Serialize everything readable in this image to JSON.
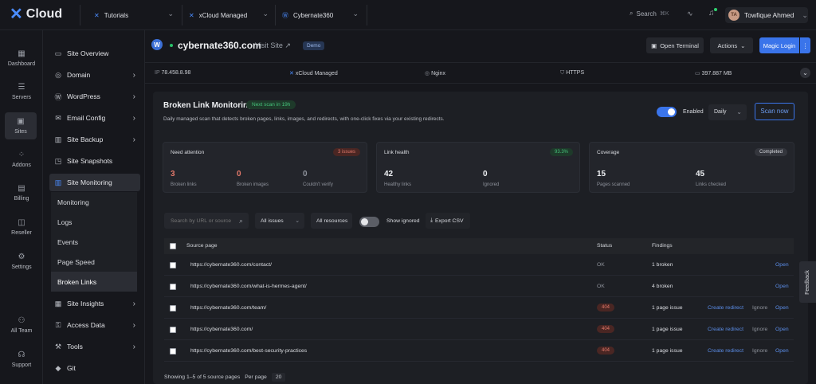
{
  "topbar": {
    "logo": "Cloud",
    "selectors": [
      "Tutorials",
      "xCloud Managed",
      "Cybernate360"
    ],
    "search_label": "Search",
    "search_kbd": "⌘K",
    "user_initials": "TA",
    "user_name": "Towfique Ahmed"
  },
  "leftnav": [
    "Dashboard",
    "Servers",
    "Sites",
    "Addons",
    "Billing",
    "Reseller",
    "Settings",
    "All Team",
    "Support"
  ],
  "subnav": {
    "items": [
      "Site Overview",
      "Domain",
      "WordPress",
      "Email Config",
      "Site Backup",
      "Site Snapshots",
      "Site Monitoring"
    ],
    "sub_items": [
      "Monitoring",
      "Logs",
      "Events",
      "Page Speed",
      "Broken Links"
    ],
    "items_bottom": [
      "Site Insights",
      "Access Data",
      "Tools",
      "Git"
    ]
  },
  "header": {
    "site": "cybernate360.com",
    "visit": "Visit Site ↗",
    "badge": "Demo",
    "open_terminal": "Open Terminal",
    "actions": "Actions",
    "magic_login": "Magic Login"
  },
  "info": {
    "ip_label": "IP",
    "ip": "78.458.8.98",
    "managed": "xCloud Managed",
    "server": "Nginx",
    "https": "HTTPS",
    "size": "397.887 MB"
  },
  "monitor": {
    "title": "Broken Link Monitoring",
    "next_scan": "Next scan in 19h",
    "description": "Daily managed scan that detects broken pages, links, images, and redirects, with one-click fixes via your existing redirects.",
    "enabled_label": "Enabled",
    "frequency": "Daily",
    "scan_now": "Scan now"
  },
  "stats": {
    "attention": {
      "title": "Need attention",
      "badge": "3 issues",
      "m1": "3",
      "l1": "Broken links",
      "m2": "0",
      "l2": "Broken images",
      "m3": "0",
      "l3": "Couldn't verify"
    },
    "health": {
      "title": "Link health",
      "badge": "93.3%",
      "m1": "42",
      "l1": "Healthy links",
      "m2": "0",
      "l2": "Ignored"
    },
    "coverage": {
      "title": "Coverage",
      "badge": "Completed",
      "m1": "15",
      "l1": "Pages scanned",
      "m2": "45",
      "l2": "Links checked"
    }
  },
  "filters": {
    "search_placeholder": "Search by URL or source",
    "issues": "All issues",
    "resources": "All resources",
    "show_ignored": "Show ignored",
    "export": "Export CSV"
  },
  "table": {
    "headers": {
      "source": "Source page",
      "status": "Status",
      "findings": "Findings"
    },
    "rows": [
      {
        "url": "https://cybernate360.com/contact/",
        "status": "OK",
        "finding": "1 broken",
        "actions": [
          "Open"
        ]
      },
      {
        "url": "https://cybernate360.com/what-is-hermes-agent/",
        "status": "OK",
        "finding": "4 broken",
        "actions": [
          "Open"
        ]
      },
      {
        "url": "https://cybernate360.com/team/",
        "status": "404",
        "finding": "1 page issue",
        "actions": [
          "Create redirect",
          "Ignore",
          "Open"
        ]
      },
      {
        "url": "https://cybernate360.com/",
        "status": "404",
        "finding": "1 page issue",
        "actions": [
          "Create redirect",
          "Ignore",
          "Open"
        ]
      },
      {
        "url": "https://cybernate360.com/best-security-practices",
        "status": "404",
        "finding": "1 page issue",
        "actions": [
          "Create redirect",
          "Ignore",
          "Open"
        ]
      }
    ],
    "footer": "Showing 1–5 of 5 source pages",
    "per_page_label": "Per page",
    "per_page": "20"
  },
  "feedback": "Feedback"
}
